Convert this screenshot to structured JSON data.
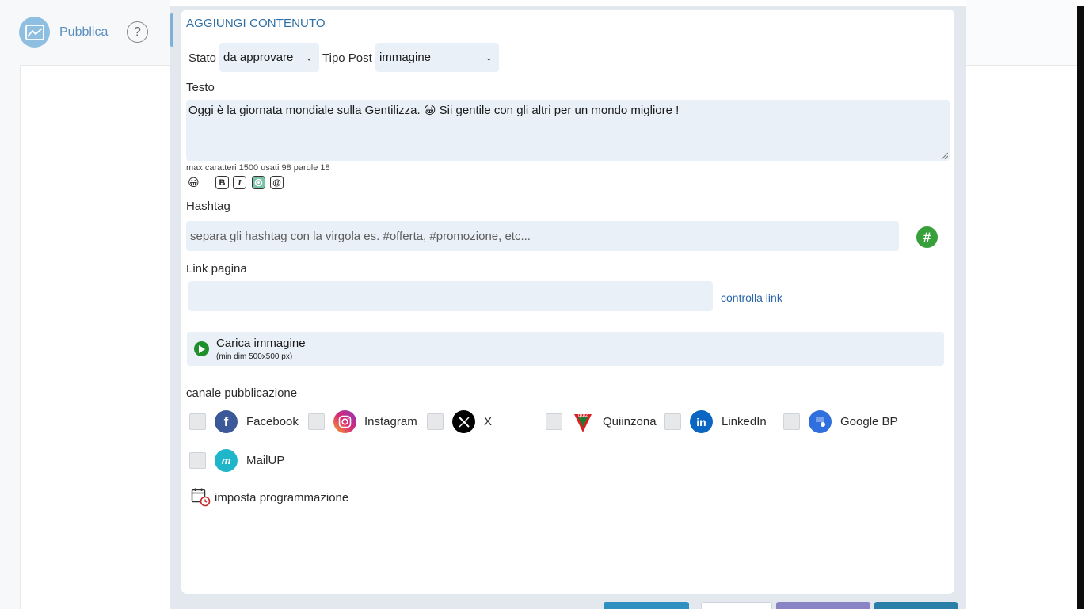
{
  "brand": {
    "label": "Pubblica",
    "help": "?"
  },
  "form": {
    "title": "AGGIUNGI CONTENUTO",
    "stato": {
      "label": "Stato",
      "value": "da approvare"
    },
    "tipo_post": {
      "label": "Tipo Post",
      "value": "immagine"
    },
    "testo": {
      "label": "Testo",
      "value": "Oggi è la giornata mondiale sulla Gentilizza. 😀 Sii gentile con gli altri per un mondo migliore !",
      "counter": "max caratteri 1500 usati 98 parole 18"
    },
    "toolbar": {
      "emoji": "😀",
      "bold": "B",
      "italic": "I",
      "ai": "⚙",
      "mention": "@"
    },
    "hashtag": {
      "label": "Hashtag",
      "placeholder": "separa gli hashtag con la virgola es. #offerta, #promozione, etc...",
      "button": "#"
    },
    "link": {
      "label": "Link pagina",
      "value": "",
      "check_label": "controlla link"
    },
    "upload": {
      "title": "Carica immagine",
      "subtitle": "(min dim 500x500 px)"
    },
    "channels": {
      "label": "canale pubblicazione",
      "items": [
        {
          "name": "Facebook",
          "icon": "facebook-icon",
          "color": "#3b5998"
        },
        {
          "name": "Instagram",
          "icon": "instagram-icon",
          "color": "#d62976"
        },
        {
          "name": "X",
          "icon": "x-icon",
          "color": "#000000"
        },
        {
          "name": "Quiinzona",
          "icon": "quiinzona-icon",
          "color": "#d81f26"
        },
        {
          "name": "LinkedIn",
          "icon": "linkedin-icon",
          "color": "#0a66c2"
        },
        {
          "name": "Google BP",
          "icon": "google-bp-icon",
          "color": "#4285f4"
        },
        {
          "name": "MailUP",
          "icon": "mailup-icon",
          "color": "#1fb6c9"
        }
      ]
    },
    "schedule": {
      "label": "imposta programmazione"
    }
  }
}
